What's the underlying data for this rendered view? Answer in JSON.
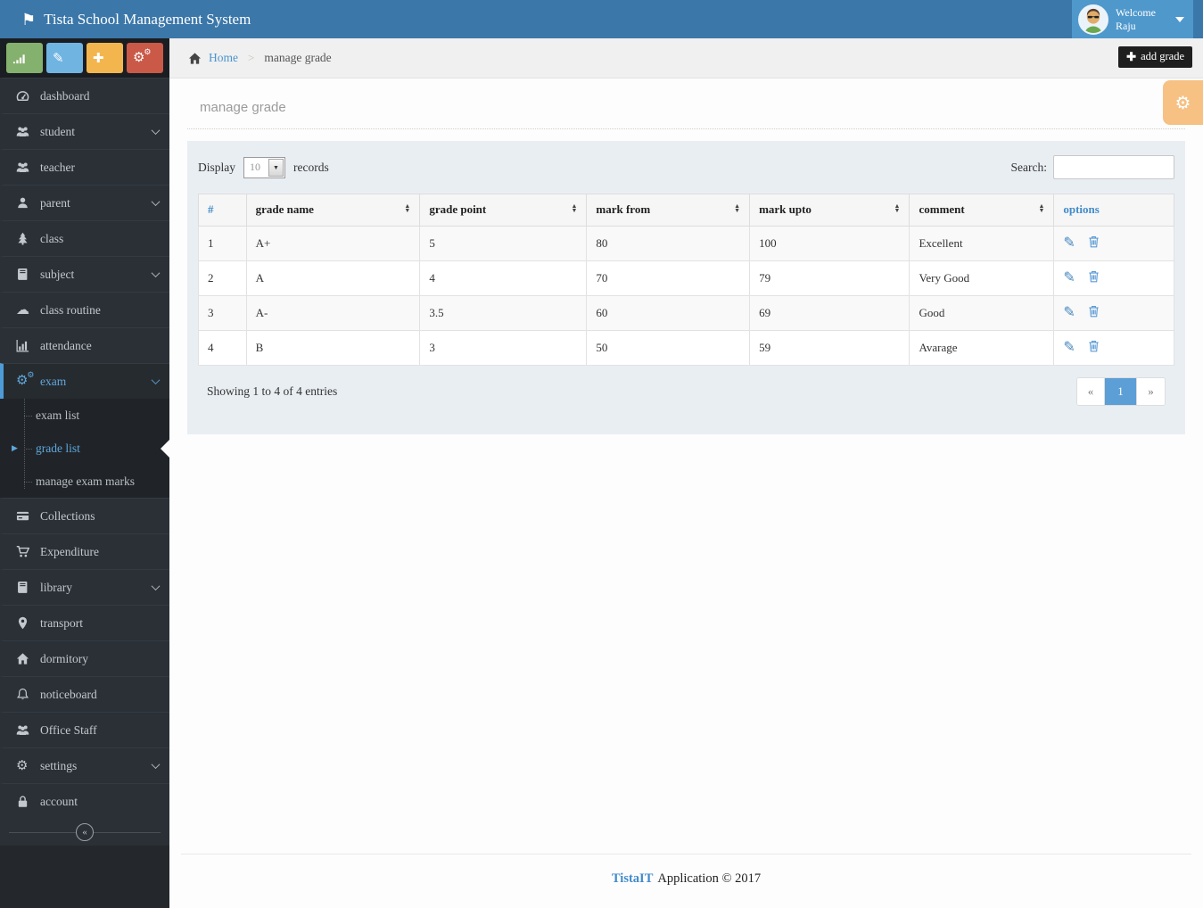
{
  "app": {
    "title": "Tista School Management System"
  },
  "user": {
    "line1": "Welcome",
    "line2": "Raju"
  },
  "quick_buttons": [
    {
      "id": "reports",
      "icon": "signal",
      "color": "#84b16e"
    },
    {
      "id": "edit",
      "icon": "pencil",
      "color": "#70b4e2"
    },
    {
      "id": "add",
      "icon": "plus",
      "color": "#f3b64e"
    },
    {
      "id": "tools",
      "icon": "cogs",
      "color": "#ca5948"
    }
  ],
  "sidebar": {
    "collapse_label": "«",
    "items": [
      {
        "id": "dashboard",
        "icon": "gauge",
        "label": "dashboard",
        "chevron": false
      },
      {
        "id": "student",
        "icon": "users",
        "label": "student",
        "chevron": true
      },
      {
        "id": "teacher",
        "icon": "users",
        "label": "teacher",
        "chevron": false
      },
      {
        "id": "parent",
        "icon": "user",
        "label": "parent",
        "chevron": true
      },
      {
        "id": "class",
        "icon": "tree",
        "label": "class",
        "chevron": false
      },
      {
        "id": "subject",
        "icon": "book",
        "label": "subject",
        "chevron": true
      },
      {
        "id": "class-routine",
        "icon": "cloud",
        "label": "class routine",
        "chevron": false
      },
      {
        "id": "attendance",
        "icon": "bar-chart",
        "label": "attendance",
        "chevron": false
      },
      {
        "id": "exam",
        "icon": "cogs",
        "label": "exam",
        "chevron": true,
        "active": true,
        "submenu": [
          {
            "id": "exam-list",
            "label": "exam list",
            "active": false
          },
          {
            "id": "grade-list",
            "label": "grade list",
            "active": true
          },
          {
            "id": "manage-exam-marks",
            "label": "manage exam marks",
            "active": false
          }
        ]
      },
      {
        "id": "collections",
        "icon": "credit-card",
        "label": "Collections",
        "chevron": false
      },
      {
        "id": "expenditure",
        "icon": "cart",
        "label": "Expenditure",
        "chevron": false
      },
      {
        "id": "library",
        "icon": "book",
        "label": "library",
        "chevron": true
      },
      {
        "id": "transport",
        "icon": "map-marker",
        "label": "transport",
        "chevron": false
      },
      {
        "id": "dormitory",
        "icon": "home",
        "label": "dormitory",
        "chevron": false
      },
      {
        "id": "noticeboard",
        "icon": "bell",
        "label": "noticeboard",
        "chevron": false
      },
      {
        "id": "office-staff",
        "icon": "users",
        "label": "Office Staff",
        "chevron": false
      },
      {
        "id": "settings",
        "icon": "gear",
        "label": "settings",
        "chevron": true
      },
      {
        "id": "account",
        "icon": "lock",
        "label": "account",
        "chevron": false
      }
    ]
  },
  "breadcrumb": {
    "home": "Home",
    "separator": ">",
    "current": "manage grade"
  },
  "actions": {
    "add_grade": "add grade"
  },
  "page": {
    "title": "manage grade"
  },
  "grid": {
    "display_label": "Display",
    "display_value": "10",
    "records_label": "records",
    "search_label": "Search:",
    "search_value": "",
    "columns": [
      {
        "label": "#",
        "sortable": false,
        "accent": true
      },
      {
        "label": "grade name",
        "sortable": true,
        "accent": false
      },
      {
        "label": "grade point",
        "sortable": true,
        "accent": false
      },
      {
        "label": "mark from",
        "sortable": true,
        "accent": false
      },
      {
        "label": "mark upto",
        "sortable": true,
        "accent": false
      },
      {
        "label": "comment",
        "sortable": true,
        "accent": false
      },
      {
        "label": "options",
        "sortable": false,
        "accent": true
      }
    ],
    "rows": [
      {
        "num": "1",
        "grade_name": "A+",
        "grade_point": "5",
        "mark_from": "80",
        "mark_upto": "100",
        "comment": "Excellent"
      },
      {
        "num": "2",
        "grade_name": "A",
        "grade_point": "4",
        "mark_from": "70",
        "mark_upto": "79",
        "comment": "Very Good"
      },
      {
        "num": "3",
        "grade_name": "A-",
        "grade_point": "3.5",
        "mark_from": "60",
        "mark_upto": "69",
        "comment": "Good"
      },
      {
        "num": "4",
        "grade_name": "B",
        "grade_point": "3",
        "mark_from": "50",
        "mark_upto": "59",
        "comment": "Avarage"
      }
    ],
    "summary": "Showing 1 to 4 of 4 entries",
    "pagination": {
      "prev": "«",
      "pages": [
        "1"
      ],
      "active": "1",
      "next": "»"
    }
  },
  "footer": {
    "brand": "TistaIT",
    "text": "Application © 2017"
  },
  "colors": {
    "topbar": "#3b77a9",
    "topbar_user": "#4f98cc",
    "sidebar": "#2b3037",
    "sidebar_submenu": "#202428",
    "accent_blue": "#428bca",
    "active_item": "#5ea6dc",
    "fab_orange": "#f6c183",
    "card_bg": "#e9eef3",
    "pagination_active": "#5b9fd6",
    "add_button": "#1f1f1f"
  }
}
